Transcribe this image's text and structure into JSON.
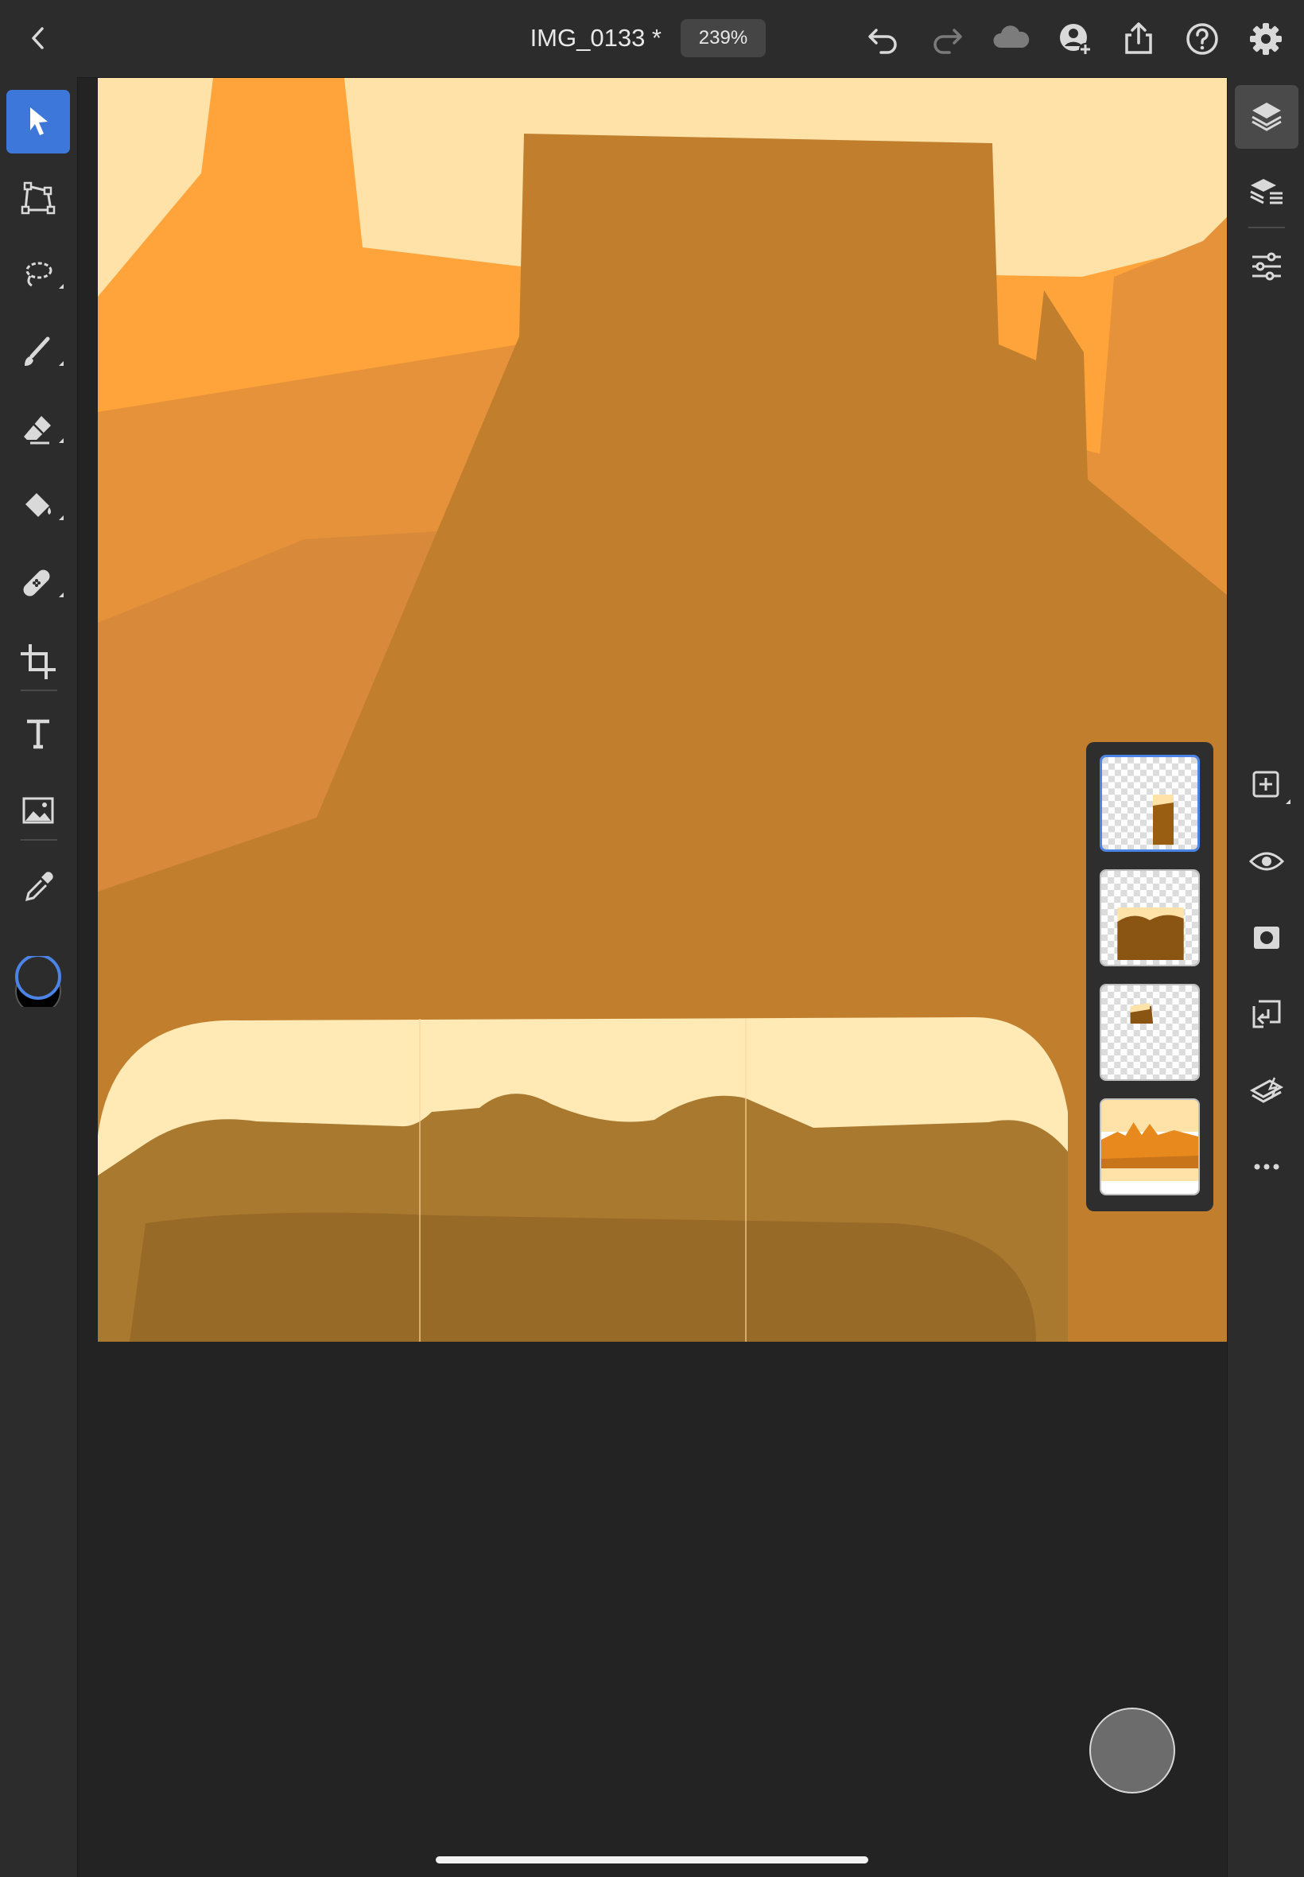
{
  "header": {
    "document_name": "IMG_0133 *",
    "zoom_level": "239%"
  },
  "toolbar": {
    "left_tools": [
      "select-tool",
      "transform-tool",
      "lasso-tool",
      "brush-tool",
      "eraser-tool",
      "fill-tool",
      "healing-tool",
      "crop-tool",
      "type-tool",
      "place-image-tool",
      "eyedropper-tool"
    ],
    "right_tools": [
      "layers-panel",
      "layer-properties",
      "adjustments",
      "add-layer",
      "visibility",
      "mask",
      "clipping",
      "layer-effects",
      "more-options"
    ]
  },
  "colors": {
    "accent": "#3c77d9",
    "foreground_swatch": "#2c2c2c",
    "background_swatch": "#000000",
    "sky": "#ffe2a8",
    "orange": "#ffa43a",
    "mid_orange": "#e6923a",
    "butte": "#c17f2e",
    "sand": "#a9792f"
  },
  "layers": [
    {
      "name": "layer-1",
      "selected": true
    },
    {
      "name": "layer-2",
      "selected": false
    },
    {
      "name": "layer-3",
      "selected": false
    },
    {
      "name": "layer-4",
      "selected": false
    }
  ]
}
